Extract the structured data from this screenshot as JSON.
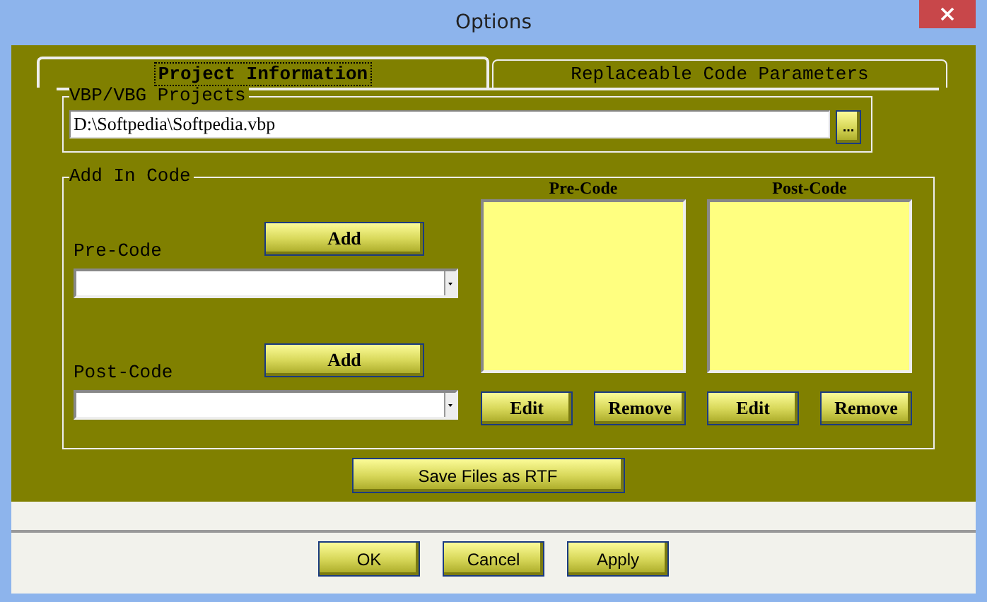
{
  "window": {
    "title": "Options"
  },
  "tabs": [
    {
      "label": "Project Information",
      "selected": true
    },
    {
      "label": "Replaceable Code Parameters",
      "selected": false
    }
  ],
  "projects_group": {
    "label": "VBP/VBG Projects",
    "path": "D:\\Softpedia\\Softpedia.vbp",
    "browse_button": "..."
  },
  "add_in_code": {
    "label": "Add In Code",
    "inputs": [
      {
        "label": "Pre-Code",
        "button": "Add"
      },
      {
        "label": "Post-Code",
        "button": "Add"
      }
    ],
    "lists": [
      {
        "title": "Pre-Code",
        "buttons": [
          "Edit",
          "Remove"
        ]
      },
      {
        "title": "Post-Code",
        "buttons": [
          "Edit",
          "Remove"
        ]
      }
    ]
  },
  "save_button": "Save Files as RTF",
  "buttons": [
    "OK",
    "Cancel",
    "Apply"
  ]
}
